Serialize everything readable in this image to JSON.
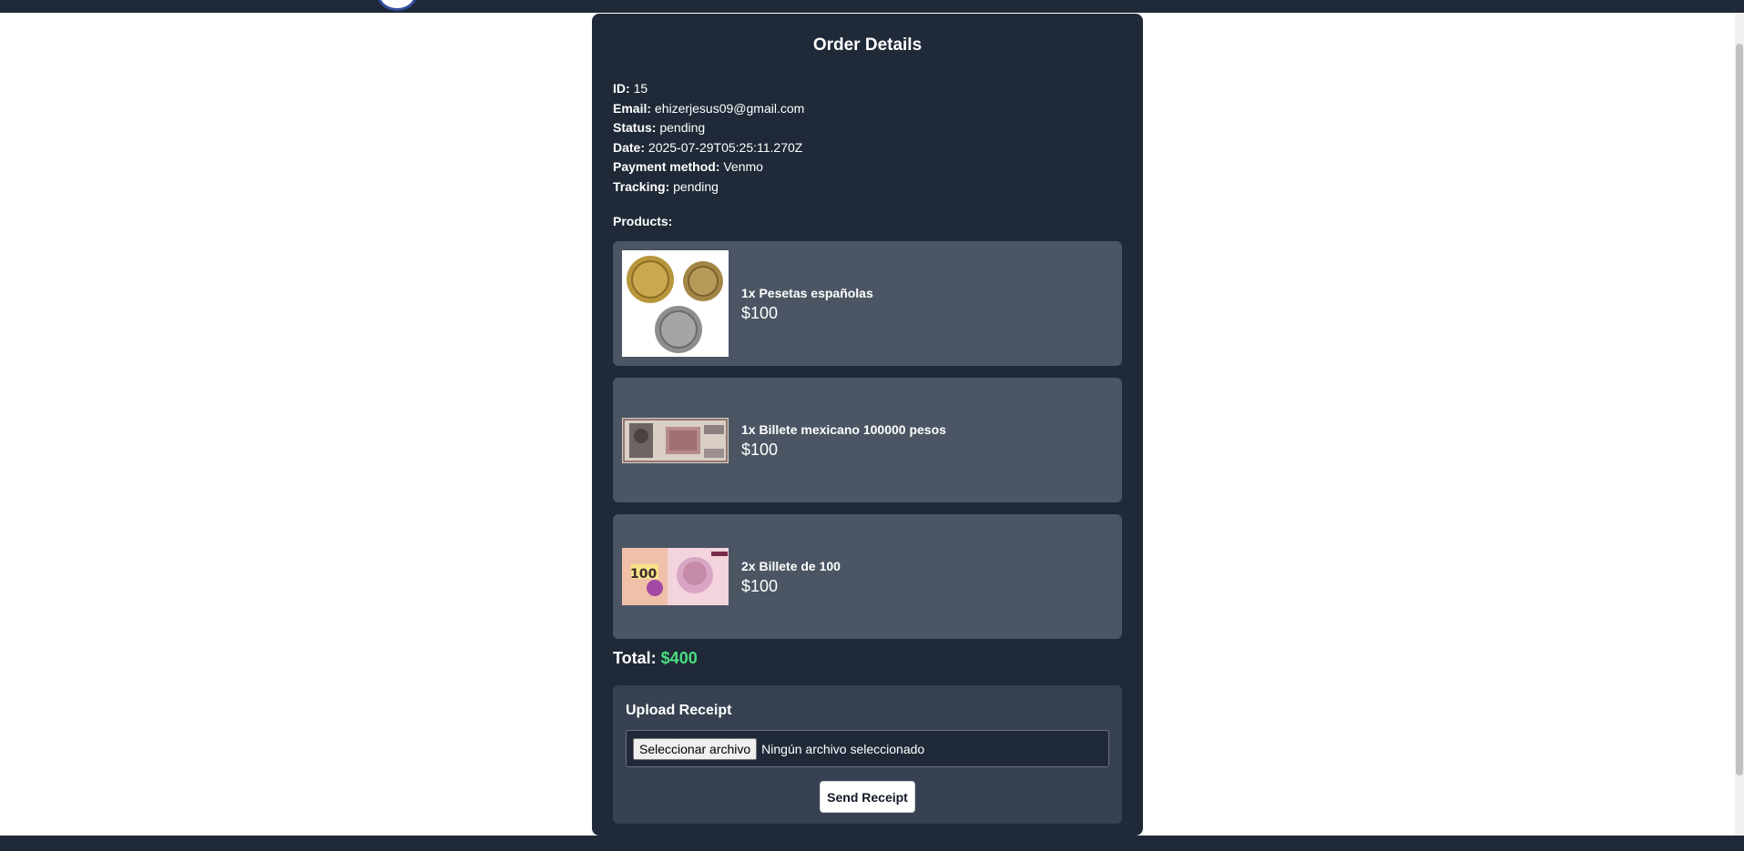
{
  "order": {
    "title": "Order Details",
    "id_label": "ID:",
    "id_value": "15",
    "email_label": "Email:",
    "email_value": "ehizerjesus09@gmail.com",
    "status_label": "Status:",
    "status_value": "pending",
    "date_label": "Date:",
    "date_value": "2025-07-29T05:25:11.270Z",
    "payment_label": "Payment method:",
    "payment_value": "Venmo",
    "tracking_label": "Tracking:",
    "tracking_value": "pending",
    "products_label": "Products:",
    "products": [
      {
        "name": "1x Pesetas españolas",
        "price": "$100",
        "image": "coins-image"
      },
      {
        "name": "1x Billete mexicano 100000 pesos",
        "price": "$100",
        "image": "mexican-banknote-image"
      },
      {
        "name": "2x Billete de 100",
        "price": "$100",
        "image": "argentine-banknote-image"
      }
    ],
    "total_label": "Total:",
    "total_value": "$400"
  },
  "upload": {
    "title": "Upload Receipt",
    "file_button": "Seleccionar archivo",
    "file_status": "Ningún archivo seleccionado",
    "send_button": "Send Receipt"
  },
  "colors": {
    "card_bg": "#1f2937",
    "product_bg": "#4b5563",
    "upload_bg": "#374151",
    "total_accent": "#4ade80"
  }
}
